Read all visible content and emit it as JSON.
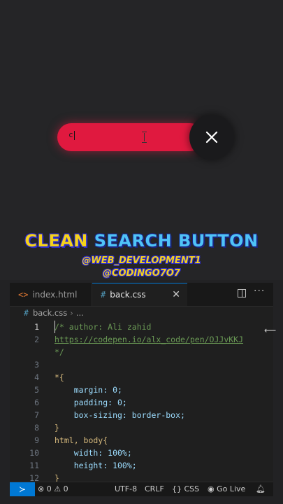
{
  "demo": {
    "search_value": "c",
    "close_icon": "close-icon",
    "accent_color": "#e0193f"
  },
  "overlay": {
    "title_word1": "CLEAN",
    "title_word2": "SEARCH BUTTON",
    "handle1": "@WEB_DEVELOPMENT1",
    "handle2": "@CODINGO7O7"
  },
  "editor": {
    "tabs": [
      {
        "label": "index.html",
        "icon": "html-file-icon"
      },
      {
        "label": "back.css",
        "icon": "css-file-icon",
        "active": true
      }
    ],
    "breadcrumb": {
      "file": "back.css",
      "more": "..."
    },
    "lines": [
      {
        "n": "1",
        "text": "/* author: Ali zahid"
      },
      {
        "n": "2",
        "text": "https://codepen.io/alx_code/pen/OJJvKKJ"
      },
      {
        "n": "",
        "text": "*/"
      },
      {
        "n": "3",
        "text": ""
      },
      {
        "n": "4",
        "text": "*{"
      },
      {
        "n": "5",
        "text": "    margin: 0;"
      },
      {
        "n": "6",
        "text": "    padding: 0;"
      },
      {
        "n": "7",
        "text": "    box-sizing: border-box;"
      },
      {
        "n": "8",
        "text": "}"
      },
      {
        "n": "9",
        "text": "html, body{"
      },
      {
        "n": "10",
        "text": "    width: 100%;"
      },
      {
        "n": "11",
        "text": "    height: 100%;"
      },
      {
        "n": "12",
        "text": "}"
      }
    ],
    "status": {
      "errors": "0",
      "warnings": "0",
      "encoding": "UTF-8",
      "eol": "CRLF",
      "language": "CSS",
      "golive": "Go Live"
    }
  }
}
